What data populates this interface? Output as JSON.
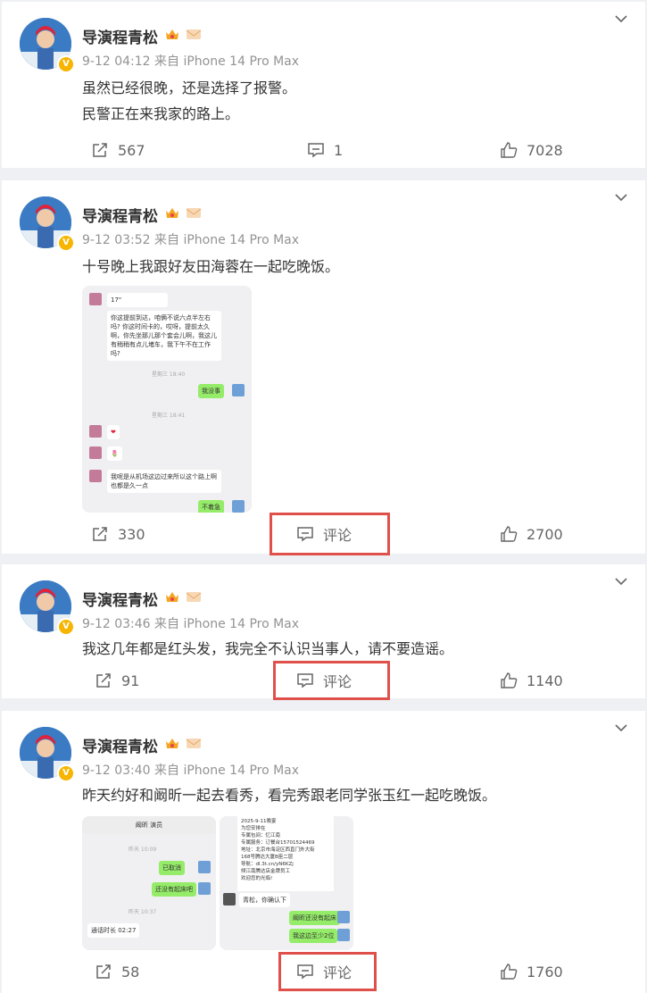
{
  "posts": [
    {
      "author": "导演程青松",
      "meta": "9-12 04:12 来自 iPhone 14 Pro Max",
      "lines": [
        "虽然已经很晚，还是选择了报警。",
        "民警正在来我家的路上。"
      ],
      "share": "567",
      "comment": "1",
      "like": "7028"
    },
    {
      "author": "导演程青松",
      "meta": "9-12 03:52 来自 iPhone 14 Pro Max",
      "lines": [
        "十号晚上我跟好友田海蓉在一起吃晚饭。"
      ],
      "share": "330",
      "comment": "评论",
      "like": "2700",
      "chat": {
        "voice": "17\"",
        "msg1": "你这提前到达，咱俩不说六点半左右吗? 你这时间卡的，哎呀，提前太久啊，你先坐那儿那个套会儿啊，我这儿有稍稍有点儿堵车，我下午不在工作吗?",
        "time1": "星期三 18:40",
        "reply1": "我没事",
        "time2": "星期三 18:41",
        "msg_heart": "❤",
        "msg_flower": "🌷",
        "msg2": "我呢是从机场这边过来所以这个路上啊也都是久一点",
        "reply2": "不着急"
      }
    },
    {
      "author": "导演程青松",
      "meta": "9-12 03:46 来自 iPhone 14 Pro Max",
      "lines": [
        "我这几年都是红头发，我完全不认识当事人，请不要造谣。"
      ],
      "share": "91",
      "comment": "评论",
      "like": "1140"
    },
    {
      "author": "导演程青松",
      "meta": "9-12 03:40 来自 iPhone 14 Pro Max",
      "lines": [
        "昨天约好和阚昕一起去看秀，看完秀跟老同学张玉红一起吃晚饭。"
      ],
      "share": "58",
      "comment": "评论",
      "like": "1760",
      "chatA": {
        "title": "阚昕 演员",
        "time1": "昨天 10:09",
        "b1": "已取消",
        "b2": "还没有起床吧",
        "time2": "昨天 10:37",
        "call": "通话时长 02:27"
      },
      "chatB": {
        "l1": "2025-9-11晚宴",
        "l2": "为您安排在",
        "l3": "专属包间：忆江南",
        "l4": "专属服务：订餐台15701524469",
        "l5": "地址：北京市海淀区西直门外大街",
        "l6": "168号腾达大厦B座二层",
        "l7": "导航：dl.3t.cn/yN6KZj",
        "l8": "倾江南腾达店金牌员工",
        "l9": "欢迎您的光临!",
        "b1": "青松，你确认下",
        "b2": "阚昕还没有起床",
        "b3": "我这边至少2位"
      }
    }
  ],
  "icons": {
    "share": "share-icon",
    "comment": "comment-icon",
    "like": "like-icon",
    "more": "chevron-down-icon",
    "verified": "verified-badge-icon"
  },
  "verified_mark": "V",
  "colors": {
    "highlight": "#e0504a",
    "verified": "#f7b500"
  }
}
